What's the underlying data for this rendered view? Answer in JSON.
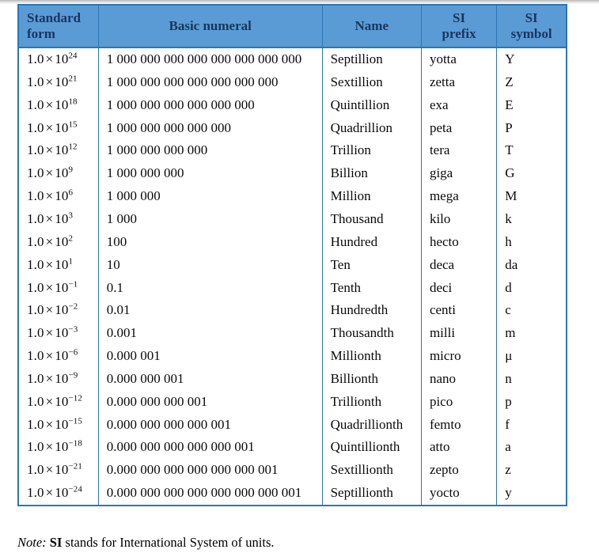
{
  "table": {
    "headers": [
      {
        "label": "Standard form",
        "line1": "Standard",
        "line2": "form",
        "align": "left"
      },
      {
        "label": "Basic numeral",
        "line1": "Basic numeral",
        "line2": "",
        "align": "center"
      },
      {
        "label": "Name",
        "line1": "Name",
        "line2": "",
        "align": "center"
      },
      {
        "label": "SI prefix",
        "line1": "SI",
        "line2": "prefix",
        "align": "center"
      },
      {
        "label": "SI symbol",
        "line1": "SI",
        "line2": "symbol",
        "align": "center"
      }
    ],
    "rows": [
      {
        "mantissa": "1.0",
        "base": "10",
        "exponent": "24",
        "numeral": "1 000 000 000 000 000 000 000 000",
        "name": "Septillion",
        "prefix": "yotta",
        "symbol": "Y"
      },
      {
        "mantissa": "1.0",
        "base": "10",
        "exponent": "21",
        "numeral": "1 000 000 000 000 000 000 000",
        "name": "Sextillion",
        "prefix": "zetta",
        "symbol": "Z"
      },
      {
        "mantissa": "1.0",
        "base": "10",
        "exponent": "18",
        "numeral": "1 000 000 000 000 000 000",
        "name": "Quintillion",
        "prefix": "exa",
        "symbol": "E"
      },
      {
        "mantissa": "1.0",
        "base": "10",
        "exponent": "15",
        "numeral": "1 000 000 000 000 000",
        "name": "Quadrillion",
        "prefix": "peta",
        "symbol": "P"
      },
      {
        "mantissa": "1.0",
        "base": "10",
        "exponent": "12",
        "numeral": "1 000 000 000 000",
        "name": "Trillion",
        "prefix": "tera",
        "symbol": "T"
      },
      {
        "mantissa": "1.0",
        "base": "10",
        "exponent": "9",
        "numeral": "1 000 000 000",
        "name": "Billion",
        "prefix": "giga",
        "symbol": "G"
      },
      {
        "mantissa": "1.0",
        "base": "10",
        "exponent": "6",
        "numeral": "1 000 000",
        "name": "Million",
        "prefix": "mega",
        "symbol": "M"
      },
      {
        "mantissa": "1.0",
        "base": "10",
        "exponent": "3",
        "numeral": "1 000",
        "name": "Thousand",
        "prefix": "kilo",
        "symbol": "k"
      },
      {
        "mantissa": "1.0",
        "base": "10",
        "exponent": "2",
        "numeral": "100",
        "name": "Hundred",
        "prefix": "hecto",
        "symbol": "h"
      },
      {
        "mantissa": "1.0",
        "base": "10",
        "exponent": "1",
        "numeral": "10",
        "name": "Ten",
        "prefix": "deca",
        "symbol": "da"
      },
      {
        "mantissa": "1.0",
        "base": "10",
        "exponent": "−1",
        "numeral": "0.1",
        "name": "Tenth",
        "prefix": "deci",
        "symbol": "d"
      },
      {
        "mantissa": "1.0",
        "base": "10",
        "exponent": "−2",
        "numeral": "0.01",
        "name": "Hundredth",
        "prefix": "centi",
        "symbol": "c"
      },
      {
        "mantissa": "1.0",
        "base": "10",
        "exponent": "−3",
        "numeral": "0.001",
        "name": "Thousandth",
        "prefix": "milli",
        "symbol": "m"
      },
      {
        "mantissa": "1.0",
        "base": "10",
        "exponent": "−6",
        "numeral": "0.000 001",
        "name": "Millionth",
        "prefix": "micro",
        "symbol": "μ"
      },
      {
        "mantissa": "1.0",
        "base": "10",
        "exponent": "−9",
        "numeral": "0.000 000 001",
        "name": "Billionth",
        "prefix": "nano",
        "symbol": "n"
      },
      {
        "mantissa": "1.0",
        "base": "10",
        "exponent": "−12",
        "numeral": "0.000 000 000 001",
        "name": "Trillionth",
        "prefix": "pico",
        "symbol": "p"
      },
      {
        "mantissa": "1.0",
        "base": "10",
        "exponent": "−15",
        "numeral": "0.000 000 000 000 001",
        "name": "Quadrillionth",
        "prefix": "femto",
        "symbol": "f"
      },
      {
        "mantissa": "1.0",
        "base": "10",
        "exponent": "−18",
        "numeral": "0.000 000 000 000 000 001",
        "name": "Quintillionth",
        "prefix": "atto",
        "symbol": "a"
      },
      {
        "mantissa": "1.0",
        "base": "10",
        "exponent": "−21",
        "numeral": "0.000 000 000 000 000 000 001",
        "name": "Sextillionth",
        "prefix": "zepto",
        "symbol": "z"
      },
      {
        "mantissa": "1.0",
        "base": "10",
        "exponent": "−24",
        "numeral": "0.000 000 000 000 000 000 000 001",
        "name": "Septillionth",
        "prefix": "yocto",
        "symbol": "y"
      }
    ]
  },
  "note": {
    "label": "Note:",
    "si": "SI",
    "text": "stands for International System of units."
  },
  "colors": {
    "header_background": "#5b9bd5",
    "header_text": "#17365d",
    "border": "#2e75b6",
    "body_text": "#0a0a0a",
    "page_background": "#ffffff"
  }
}
